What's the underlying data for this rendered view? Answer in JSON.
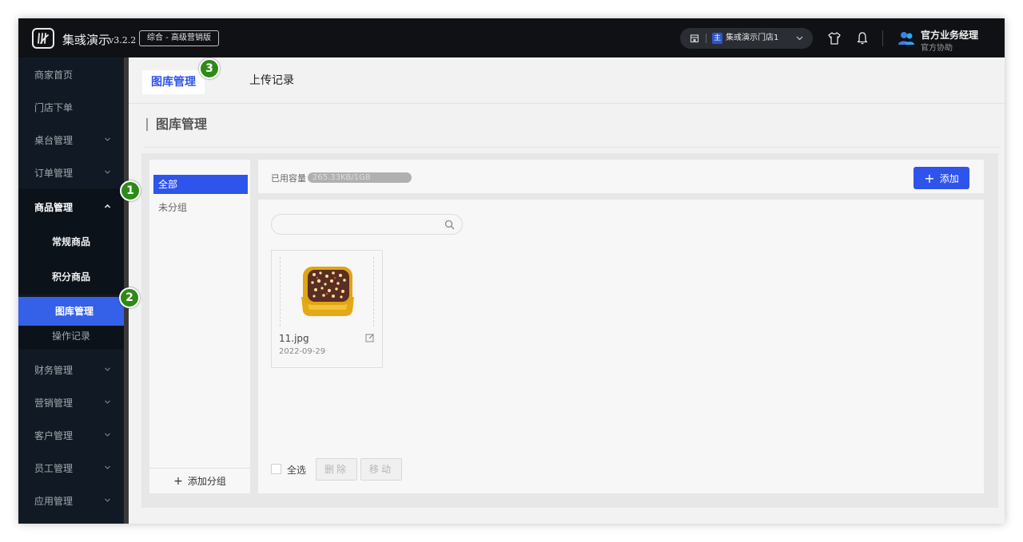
{
  "topbar": {
    "brand": "集彧演示",
    "version": "v3.2.2",
    "edition": "综合 - 高级营销版",
    "store": {
      "badge": "主",
      "name": "集彧演示门店1"
    },
    "user": {
      "name": "官方业务经理",
      "role": "官方协助"
    }
  },
  "sidebar": {
    "items": [
      {
        "label": "商家首页"
      },
      {
        "label": "门店下单"
      },
      {
        "label": "桌台管理"
      },
      {
        "label": "订单管理"
      },
      {
        "label": "商品管理"
      },
      {
        "label": "财务管理"
      },
      {
        "label": "营销管理"
      },
      {
        "label": "客户管理"
      },
      {
        "label": "员工管理"
      },
      {
        "label": "应用管理"
      }
    ],
    "sub": [
      {
        "label": "常规商品"
      },
      {
        "label": "积分商品"
      },
      {
        "label": "图库管理"
      },
      {
        "label": "操作记录"
      }
    ]
  },
  "tabs": [
    {
      "label": "图库管理"
    },
    {
      "label": "上传记录"
    }
  ],
  "page_title": "图库管理",
  "groups": {
    "all": "全部",
    "ungrouped": "未分组",
    "add": "添加分组"
  },
  "capacity": {
    "label": "已用容量",
    "value": "265.33KB/1GB",
    "used_fraction": 0.0003
  },
  "add_button": "添加",
  "search": {
    "placeholder": ""
  },
  "images": [
    {
      "name": "11.jpg",
      "date": "2022-09-29"
    }
  ],
  "footer": {
    "select_all": "全选",
    "delete": "删除",
    "move": "移动"
  },
  "callouts": [
    "1",
    "2",
    "3"
  ],
  "colors": {
    "primary": "#2f54eb",
    "sidebar": "#111a24",
    "callout": "#2e8a17"
  }
}
